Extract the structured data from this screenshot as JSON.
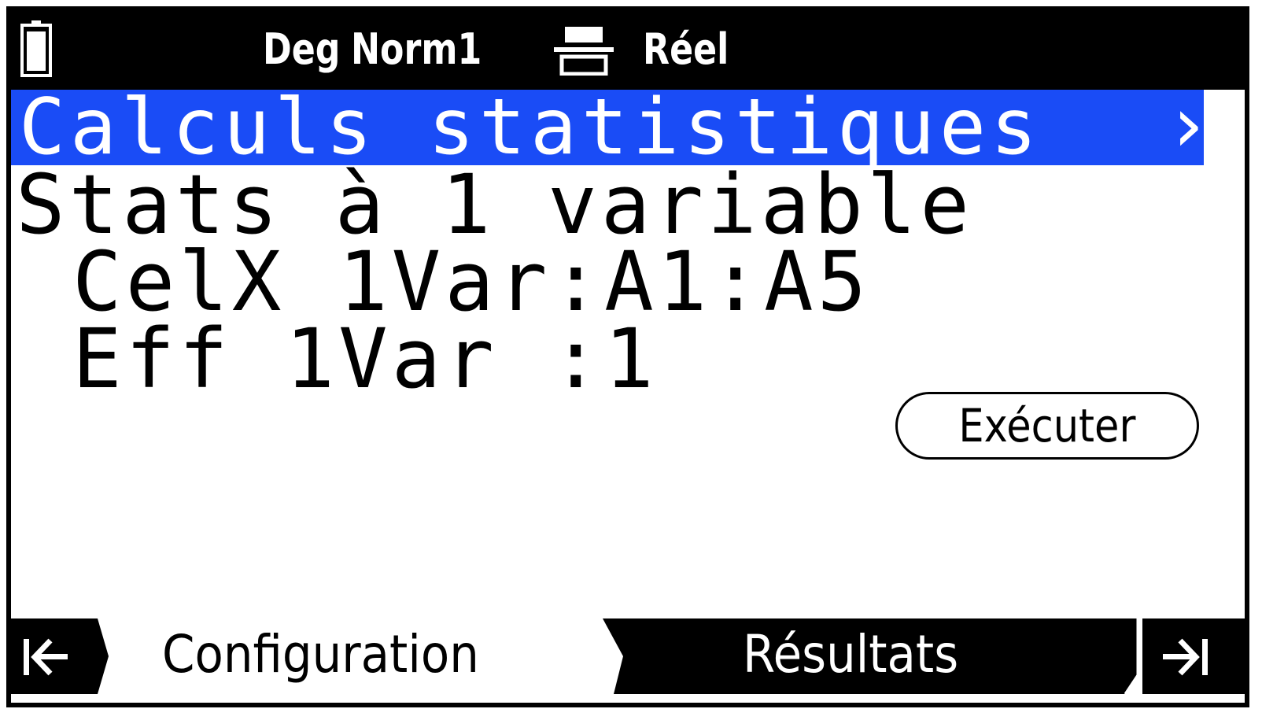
{
  "status_bar": {
    "battery_icon": "battery-icon",
    "angle_mode": "Deg",
    "display_format": "Norm1",
    "printer_icon": "printer-icon",
    "number_mode": "Réel"
  },
  "title_bar": {
    "title": "Calculs statistiques",
    "arrow": "›",
    "background_color": "#1a4cf6"
  },
  "main": {
    "lines": [
      "Stats à 1 variable",
      "CelX 1Var:A1:A5",
      "Eff 1Var :1"
    ],
    "execute_button": "Exécuter"
  },
  "tab_bar": {
    "prev_icon": "nav-first-icon",
    "tabs": [
      {
        "label": "Configuration",
        "active": true
      },
      {
        "label": "Résultats",
        "active": false
      }
    ],
    "next_icon": "nav-last-icon"
  }
}
